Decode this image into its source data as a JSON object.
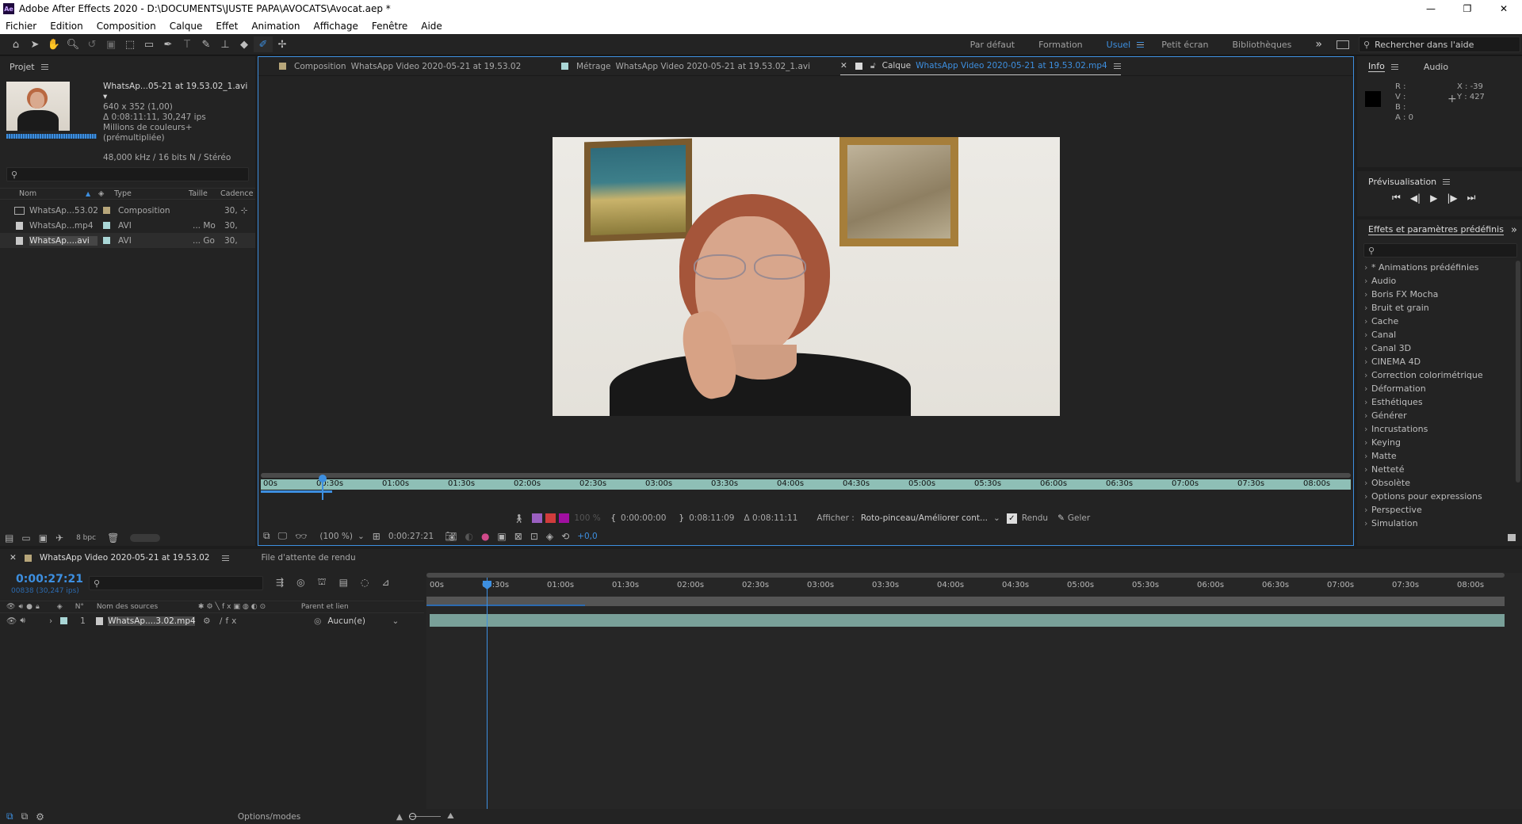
{
  "app": {
    "title": "Adobe After Effects 2020 - D:\\DOCUMENTS\\JUSTE PAPA\\AVOCATS\\Avocat.aep *",
    "icon_label": "Ae",
    "window_controls": [
      "—",
      "❐",
      "✕"
    ]
  },
  "menu": [
    "Fichier",
    "Edition",
    "Composition",
    "Calque",
    "Effet",
    "Animation",
    "Affichage",
    "Fenêtre",
    "Aide"
  ],
  "workspaces": {
    "items": [
      "Par défaut",
      "Formation",
      "Usuel",
      "Petit écran",
      "Bibliothèques"
    ],
    "active": "Usuel",
    "more": "»",
    "search_placeholder": "Rechercher dans l'aide"
  },
  "project": {
    "title": "Projet",
    "selected_name": "WhatsAp...05-21 at 19.53.02_1.avi ▾",
    "info": [
      "640 x 352 (1,00)",
      "Δ 0:08:11:11, 30,247 ips",
      "Millions de couleurs+ (prémultipliée)",
      "48,000 kHz / 16 bits N / Stéréo"
    ],
    "columns": [
      "Nom",
      "Type",
      "Taille",
      "Cadence"
    ],
    "items": [
      {
        "name": "WhatsAp...53.02",
        "type": "Composition",
        "size": "",
        "rate": "30,",
        "color": "#b7a67a"
      },
      {
        "name": "WhatsAp...mp4",
        "type": "AVI",
        "size": "... Mo",
        "rate": "30,",
        "color": "#a9d6d6"
      },
      {
        "name": "WhatsAp....avi",
        "type": "AVI",
        "size": "... Go",
        "rate": "30,",
        "color": "#a9d6d6"
      }
    ],
    "bpc": "8 bpc"
  },
  "viewer": {
    "tabs": [
      {
        "label": "Composition",
        "name": "WhatsApp Video 2020-05-21 at 19.53.02"
      },
      {
        "label": "Métrage",
        "name": "WhatsApp Video 2020-05-21 at 19.53.02_1.avi"
      },
      {
        "label": "Calque",
        "name": "WhatsApp Video 2020-05-21 at 19.53.02.mp4"
      }
    ],
    "ruler": [
      "00s",
      "00:30s",
      "01:00s",
      "01:30s",
      "02:00s",
      "02:30s",
      "03:00s",
      "03:30s",
      "04:00s",
      "04:30s",
      "05:00s",
      "05:30s",
      "06:00s",
      "06:30s",
      "07:00s",
      "07:30s",
      "08:00s"
    ],
    "playhead_fraction": 0.056,
    "opacity": "100 %",
    "in_point": "0:00:00:00",
    "out_point": "0:08:11:09",
    "duration": "Δ 0:08:11:11",
    "afficher_label": "Afficher :",
    "afficher_value": "Roto-pinceau/Améliorer cont...",
    "rendu": "Rendu",
    "geler": "Geler",
    "zoom": "(100 %)",
    "current_time": "0:00:27:21",
    "exposure": "+0,0"
  },
  "info_panel": {
    "tabs": [
      "Info",
      "Audio"
    ],
    "rgba": [
      "R :",
      "V :",
      "B :",
      "A : 0"
    ],
    "x": "X : -39",
    "y": "Y : 427",
    "swatch": "#000000"
  },
  "preview": {
    "title": "Prévisualisation",
    "controls": [
      "⏮",
      "◀|",
      "▶",
      "|▶",
      "⏭"
    ]
  },
  "effects": {
    "title": "Effets et paramètres prédéfinis",
    "items": [
      "* Animations prédéfinies",
      "Audio",
      "Boris FX Mocha",
      "Bruit et grain",
      "Cache",
      "Canal",
      "Canal 3D",
      "CINEMA 4D",
      "Correction colorimétrique",
      "Déformation",
      "Esthétiques",
      "Générer",
      "Incrustations",
      "Keying",
      "Matte",
      "Netteté",
      "Obsolète",
      "Options pour expressions",
      "Perspective",
      "Simulation"
    ]
  },
  "timeline": {
    "tab": "WhatsApp Video 2020-05-21 at 19.53.02",
    "render_queue": "File d'attente de rendu",
    "timecode": "0:00:27:21",
    "frames": "00838 (30,247 ips)",
    "columns": {
      "num": "N°",
      "source": "Nom des sources",
      "parent": "Parent et lien"
    },
    "layer": {
      "num": "1",
      "name": "WhatsAp....3.02.mp4",
      "parent": "Aucun(e)"
    },
    "ruler": [
      "00s",
      "00:30s",
      "01:00s",
      "01:30s",
      "02:00s",
      "02:30s",
      "03:00s",
      "03:30s",
      "04:00s",
      "04:30s",
      "05:00s",
      "05:30s",
      "06:00s",
      "06:30s",
      "07:00s",
      "07:30s",
      "08:00s"
    ],
    "playhead_fraction": 0.056,
    "options_modes": "Options/modes"
  },
  "colors": {
    "accent": "#3d8fe0",
    "teal_bar": "#8ebfb6",
    "label_sand": "#b7a67a",
    "label_aqua": "#a9d6d6"
  }
}
